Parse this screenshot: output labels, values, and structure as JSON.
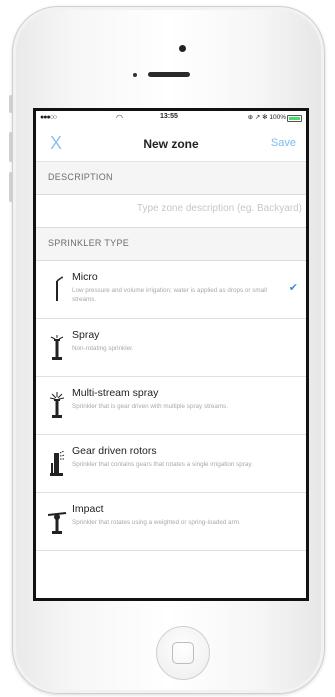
{
  "status_bar": {
    "carrier_dots": "●●●○○",
    "wifi": "◠",
    "time": "13:55",
    "right": "⊕ ↗ ✻ 100%"
  },
  "nav": {
    "close_label": "X",
    "title": "New zone",
    "save_label": "Save"
  },
  "description": {
    "header": "DESCRIPTION",
    "placeholder": "Type zone description (eg. Backyard)"
  },
  "sprinkler_type": {
    "header": "SPRINKLER TYPE",
    "items": [
      {
        "name": "Micro",
        "description": "Low pressure and volume irrigation; water is applied as drops or small streams.",
        "icon": "micro-sprinkler-icon",
        "selected": true
      },
      {
        "name": "Spray",
        "description": "Non-rotating sprinkler.",
        "icon": "spray-sprinkler-icon",
        "selected": false
      },
      {
        "name": "Multi-stream spray",
        "description": "Sprinkler that is gear driven with multiple spray streams.",
        "icon": "multi-stream-sprinkler-icon",
        "selected": false
      },
      {
        "name": "Gear driven rotors",
        "description": "Sprinkler that contains gears that rotates a single irrigation spray.",
        "icon": "gear-rotor-sprinkler-icon",
        "selected": false
      },
      {
        "name": "Impact",
        "description": "Sprinkler that rotates using a weighted or spring-loaded arm.",
        "icon": "impact-sprinkler-icon",
        "selected": false
      }
    ]
  },
  "colors": {
    "accent": "#7fbaf0",
    "check": "#3c8fe6",
    "section_bg": "#f5f5f5"
  }
}
